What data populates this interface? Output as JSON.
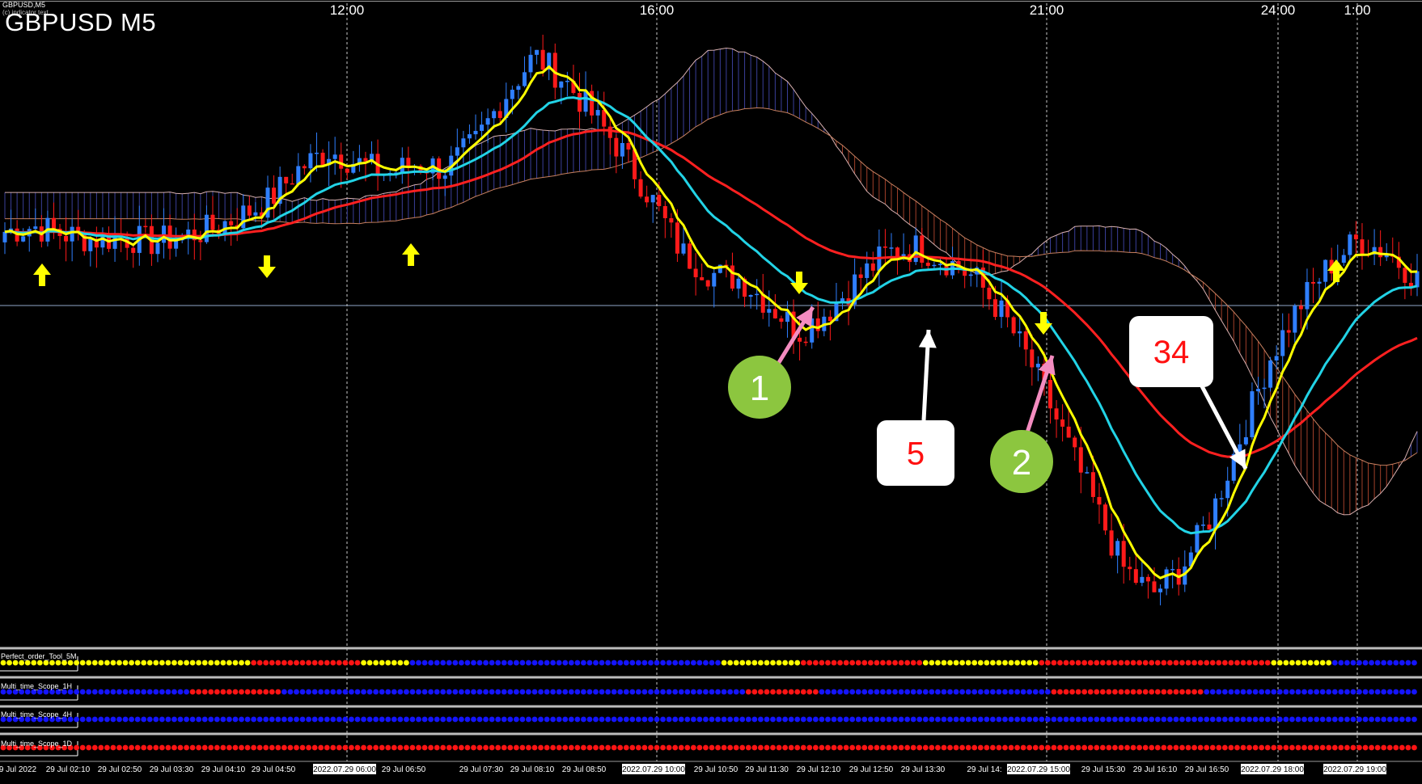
{
  "window": {
    "caption": "GBPUSD,M5",
    "sub_caption": "(c) indicator text",
    "title": "GBPUSD M5"
  },
  "top_time_labels": [
    "12:00",
    "16:00",
    "21:00",
    "24:00",
    "1:00"
  ],
  "bottom_time_labels": [
    "9 Jul 2022",
    "29 Jul 02:10",
    "29 Jul 02:50",
    "29 Jul 03:30",
    "29 Jul 04:10",
    "29 Jul 04:50",
    "2022.07.29 06:00",
    "29 Jul 06:50",
    "29 Jul 07:30",
    "29 Jul 08:10",
    "29 Jul 08:50",
    "2022.07.29 10:00",
    "29 Jul 10:50",
    "29 Jul 11:30",
    "29 Jul 12:10",
    "29 Jul 12:50",
    "29 Jul 13:30",
    "29 Jul 14:",
    "2022.07.29 15:00",
    "29 Jul 15:30",
    "29 Jul 16:10",
    "29 Jul 16:50",
    "2022.07.29 18:00",
    "2022.07.29 19:00"
  ],
  "indicator_panels": [
    {
      "label": "Perfect_order_Tool_5M"
    },
    {
      "label": "Multi_time_Scope_1H"
    },
    {
      "label": "Multi_time_Scope_4H"
    },
    {
      "label": "Multi_time_Scope_1D"
    }
  ],
  "annotations": {
    "circle_1": "1",
    "circle_2": "2",
    "box_5": "5",
    "box_34": "34"
  },
  "colors": {
    "background": "#000000",
    "bull_candle": "#2f7fff",
    "bear_candle": "#ff1a1a",
    "ma_fast": "#ffff00",
    "ma_mid": "#22d3e6",
    "ma_slow": "#ff2020",
    "arrow_signal": "#ffff00",
    "callout_green": "#8cc63f",
    "callout_pink": "#f48cc0",
    "dot_blue": "#1414ff",
    "dot_red": "#ff1414",
    "dot_yellow": "#ffff00"
  },
  "chart_data": {
    "type": "candlestick",
    "symbol": "GBPUSD",
    "timeframe": "M5",
    "close_path": [
      1.2188,
      1.219,
      1.2187,
      1.2185,
      1.2186,
      1.2184,
      1.2186,
      1.2189,
      1.2194,
      1.22,
      1.2212,
      1.2219,
      1.2214,
      1.221,
      1.2214,
      1.2212,
      1.2222,
      1.224,
      1.2255,
      1.2246,
      1.2232,
      1.2218,
      1.22,
      1.218,
      1.2172,
      1.217,
      1.216,
      1.215,
      1.2158,
      1.217,
      1.218,
      1.2182,
      1.2177,
      1.217,
      1.2155,
      1.2135,
      1.211,
      1.2085,
      1.206,
      1.205,
      1.206,
      1.208,
      1.211,
      1.214,
      1.216,
      1.2175,
      1.2185,
      1.218,
      1.217
    ],
    "signals": [
      {
        "type": "buy",
        "time": "29 Jul 02:10"
      },
      {
        "type": "sell",
        "time": "29 Jul 04:50"
      },
      {
        "type": "buy",
        "time": "29 Jul 06:50"
      },
      {
        "type": "sell",
        "time": "29 Jul 11:30"
      },
      {
        "type": "sell",
        "time": "2022.07.29 15:00"
      },
      {
        "type": "buy",
        "time": "2022.07.29 19:00"
      }
    ],
    "dot_rows": [
      {
        "name": "Perfect_order_Tool_5M",
        "segments": [
          [
            "yellow",
            41
          ],
          [
            "red",
            18
          ],
          [
            "yellow",
            8
          ],
          [
            "blue",
            51
          ],
          [
            "yellow",
            13
          ],
          [
            "red",
            20
          ],
          [
            "yellow",
            19
          ],
          [
            "red",
            38
          ],
          [
            "yellow",
            10
          ],
          [
            "blue",
            14
          ]
        ]
      },
      {
        "name": "Multi_time_Scope_1H",
        "segments": [
          [
            "blue",
            31
          ],
          [
            "red",
            15
          ],
          [
            "blue",
            76
          ],
          [
            "red",
            12
          ],
          [
            "blue",
            38
          ],
          [
            "red",
            25
          ],
          [
            "blue",
            35
          ]
        ]
      },
      {
        "name": "Multi_time_Scope_4H",
        "segments": [
          [
            "blue",
            232
          ]
        ]
      },
      {
        "name": "Multi_time_Scope_1D",
        "segments": [
          [
            "red",
            232
          ]
        ]
      }
    ]
  }
}
